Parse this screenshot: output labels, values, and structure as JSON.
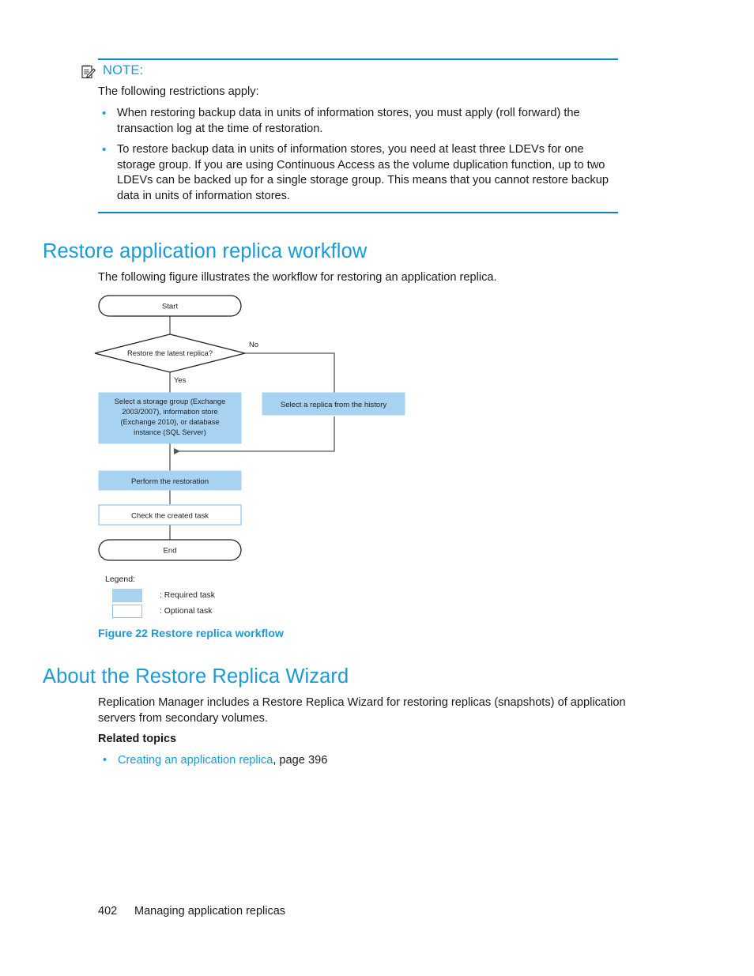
{
  "note": {
    "icon": "notepad-pencil-icon",
    "label": "NOTE:",
    "lead": "The following restrictions apply:",
    "items": [
      "When restoring backup data in units of information stores, you must apply (roll forward) the transaction log at the time of restoration.",
      "To restore backup data in units of information stores, you need at least three LDEVs for one storage group. If you are using Continuous Access as the volume duplication function, up to two LDEVs can be backed up for a single storage group. This means that you cannot restore backup data in units of information stores."
    ],
    "bullet": "•",
    "rule_color": "#0c82c4"
  },
  "sections": {
    "restore_workflow": {
      "heading": "Restore application replica workflow",
      "intro": "The following figure illustrates the workflow for restoring an application replica."
    },
    "about_wizard": {
      "heading": "About the Restore Replica Wizard",
      "paragraph": "Replication Manager includes a Restore Replica Wizard for restoring replicas (snapshots) of application servers from secondary volumes.",
      "related_topics_heading": "Related topics",
      "related_topics": [
        {
          "link_text": "Creating an application replica",
          "suffix": ", page 396",
          "bullet": "•"
        }
      ]
    }
  },
  "figure": {
    "caption": "Figure 22 Restore replica workflow",
    "nodes": {
      "start": "Start",
      "decision": "Restore the latest replica?",
      "decision_yes": "Yes",
      "decision_no": "No",
      "select_storage_group_lines": [
        "Select a storage group (Exchange",
        "2003/2007), information store",
        "(Exchange 2010), or database",
        "instance (SQL Server)"
      ],
      "select_replica_history": "Select a replica from the history",
      "perform_restoration": "Perform the restoration",
      "check_created_task": "Check the created task",
      "end": "End"
    },
    "legend": {
      "title": "Legend:",
      "required": ": Required task",
      "optional": ": Optional  task"
    },
    "colors": {
      "required_fill": "#a7d2f2",
      "optional_border": "#8fc4ea",
      "line": "#555555",
      "terminator_border": "#222222"
    }
  },
  "footer": {
    "page_number": "402",
    "chapter": "Managing application replicas"
  },
  "theme": {
    "heading_blue": "#1a9ad6",
    "link_blue": "#1a9ad6",
    "rule_blue": "#0c82c4",
    "body_text": "#1a1a1a"
  }
}
